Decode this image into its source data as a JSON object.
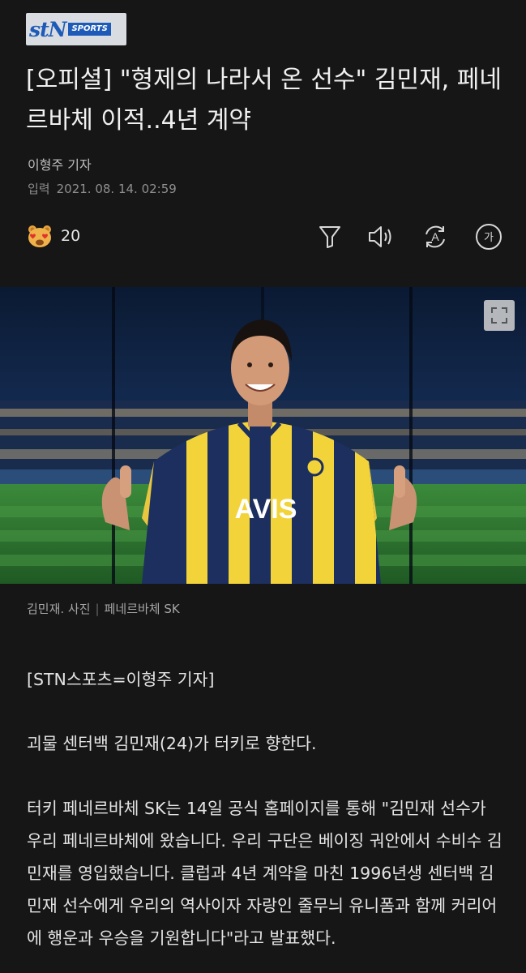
{
  "brand": {
    "logo_main": "stN",
    "logo_sub": "SPORTS"
  },
  "article": {
    "headline": "[오피셜] \"형제의 나라서 온 선수\" 김민재, 페네르바체 이적..4년 계약",
    "reporter": "이형주 기자",
    "date_label": "입력",
    "date_value": "2021. 08. 14. 02:59",
    "reaction_count": "20",
    "photo_caption": "김민재. 사진",
    "photo_credit": "페네르바체 SK",
    "paragraphs": [
      "[STN스포츠=이형주 기자]",
      "괴물 센터백 김민재(24)가 터키로 향한다.",
      "터키 페네르바체 SK는 14일 공식 홈페이지를 통해 \"김민재 선수가 우리 페네르바체에 왔습니다. 우리 구단은 베이징 궈안에서 수비수 김민재를 영입했습니다. 클럽과 4년 계약을 마친 1996년생 센터백 김민재 선수에게 우리의 역사이자 자랑인 줄무늬 유니폼과 함께 커리어에 행운과 우승을 기원합니다\"라고 발표했다."
    ]
  },
  "toolbar": {
    "filter_icon": "filter-icon",
    "speaker_icon": "speaker-icon",
    "translate_icon": "translate-icon",
    "font_icon": "font-size-icon",
    "font_glyph": "가",
    "translate_glyph": "A"
  },
  "photo": {
    "jersey_text": "AVIS"
  },
  "colors": {
    "background": "#161616",
    "logo_blue": "#1e5bb8",
    "jersey_yellow": "#f2d43a",
    "jersey_navy": "#1d2f5e"
  }
}
